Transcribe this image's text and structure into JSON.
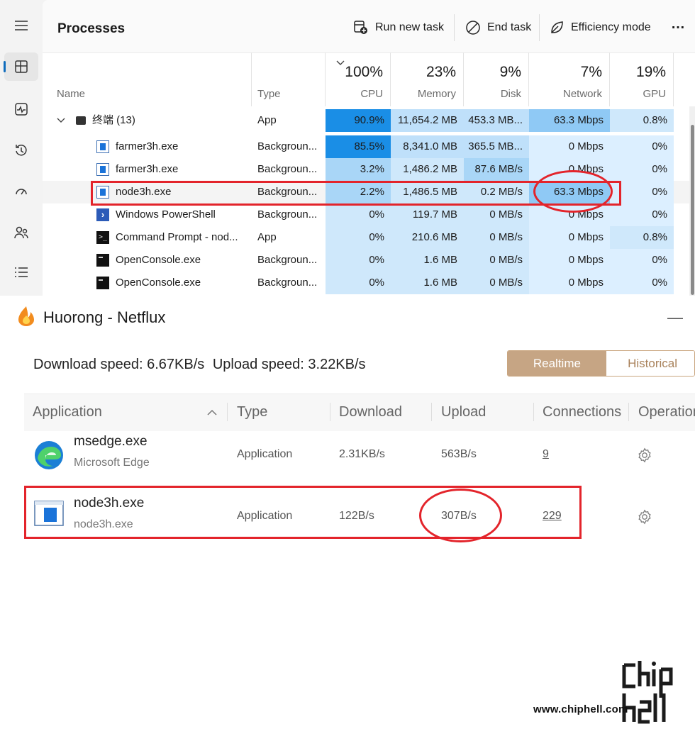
{
  "task_manager": {
    "page_title": "Processes",
    "toolbar": {
      "run_new_task": "Run new task",
      "end_task": "End task",
      "efficiency_mode": "Efficiency mode",
      "more": "…"
    },
    "nav_icons": [
      "hamburger-icon",
      "processes-icon",
      "performance-icon",
      "app-history-icon",
      "startup-apps-icon",
      "users-icon",
      "details-icon"
    ],
    "columns": {
      "name": "Name",
      "type": "Type",
      "cpu": {
        "pct": "100%",
        "label": "CPU"
      },
      "memory": {
        "pct": "23%",
        "label": "Memory"
      },
      "disk": {
        "pct": "9%",
        "label": "Disk"
      },
      "network": {
        "pct": "7%",
        "label": "Network"
      },
      "gpu": {
        "pct": "19%",
        "label": "GPU"
      }
    },
    "rows": [
      {
        "name": "终端 (13)",
        "type": "App",
        "cpu": "90.9%",
        "memory": "11,654.2 MB",
        "disk": "453.3 MB...",
        "network": "63.3 Mbps",
        "gpu": "0.8%"
      },
      {
        "name": "farmer3h.exe",
        "type": "Backgroun...",
        "cpu": "85.5%",
        "memory": "8,341.0 MB",
        "disk": "365.5 MB...",
        "network": "0 Mbps",
        "gpu": "0%"
      },
      {
        "name": "farmer3h.exe",
        "type": "Backgroun...",
        "cpu": "3.2%",
        "memory": "1,486.2 MB",
        "disk": "87.6 MB/s",
        "network": "0 Mbps",
        "gpu": "0%"
      },
      {
        "name": "node3h.exe",
        "type": "Backgroun...",
        "cpu": "2.2%",
        "memory": "1,486.5 MB",
        "disk": "0.2 MB/s",
        "network": "63.3 Mbps",
        "gpu": "0%"
      },
      {
        "name": "Windows PowerShell",
        "type": "Backgroun...",
        "cpu": "0%",
        "memory": "119.7 MB",
        "disk": "0 MB/s",
        "network": "0 Mbps",
        "gpu": "0%"
      },
      {
        "name": "Command Prompt - nod...",
        "type": "App",
        "cpu": "0%",
        "memory": "210.6 MB",
        "disk": "0 MB/s",
        "network": "0 Mbps",
        "gpu": "0.8%"
      },
      {
        "name": "OpenConsole.exe",
        "type": "Backgroun...",
        "cpu": "0%",
        "memory": "1.6 MB",
        "disk": "0 MB/s",
        "network": "0 Mbps",
        "gpu": "0%"
      },
      {
        "name": "OpenConsole.exe",
        "type": "Backgroun...",
        "cpu": "0%",
        "memory": "1.6 MB",
        "disk": "0 MB/s",
        "network": "0 Mbps",
        "gpu": "0%"
      }
    ]
  },
  "huorong": {
    "title": "Huorong - Netflux",
    "minimize": "—",
    "download_speed": "Download speed: 6.67KB/s",
    "upload_speed": "Upload speed: 3.22KB/s",
    "tabs": {
      "realtime": "Realtime",
      "historical": "Historical"
    },
    "columns": {
      "application": "Application",
      "type": "Type",
      "download": "Download",
      "upload": "Upload",
      "connections": "Connections",
      "operation": "Operation"
    },
    "rows": [
      {
        "name": "msedge.exe",
        "sub": "Microsoft Edge",
        "type": "Application",
        "download": "2.31KB/s",
        "upload": "563B/s",
        "connections": "9"
      },
      {
        "name": "node3h.exe",
        "sub": "node3h.exe",
        "type": "Application",
        "download": "122B/s",
        "upload": "307B/s",
        "connections": "229"
      }
    ]
  },
  "watermark": {
    "text": "www.chiphell.com",
    "logo": "chiphell"
  },
  "colors": {
    "highlight_red": "#e3242b",
    "heat_light": "#cfe8fb",
    "heat_mid": "#a9d6f7",
    "heat_strong": "#8fc9f5",
    "heat_max": "#1a8ee6",
    "accent_gold": "#c6a584"
  }
}
